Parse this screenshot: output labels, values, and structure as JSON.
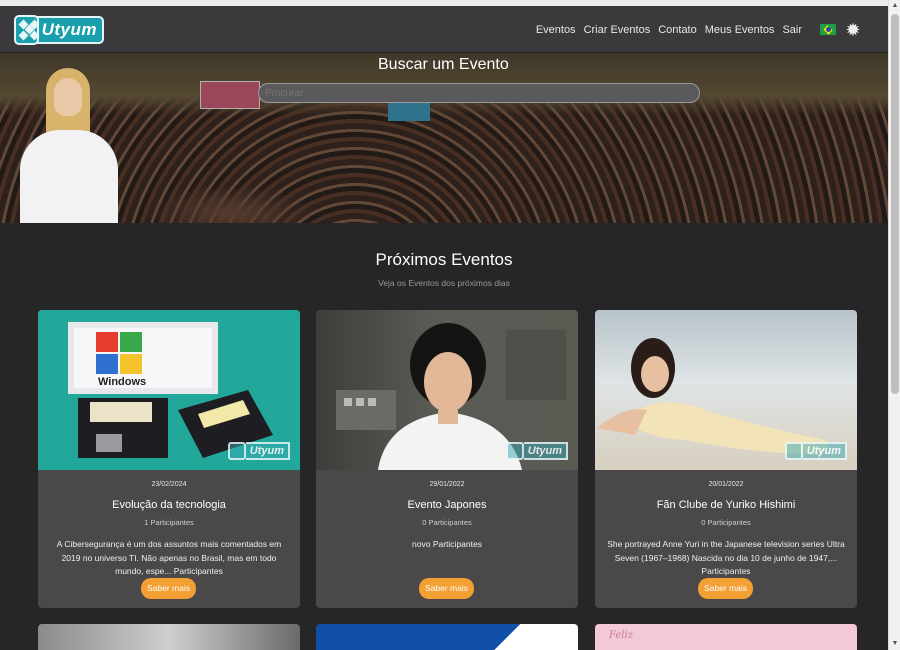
{
  "nav": {
    "logo_text": "Utyum",
    "items": [
      "Eventos",
      "Criar Eventos",
      "Contato",
      "Meus Eventos",
      "Sair"
    ],
    "language_icon": "brazil-flag-icon",
    "theme_icon": "sun-icon"
  },
  "hero": {
    "title": "Buscar um Evento",
    "search_placeholder": "Procurar"
  },
  "section": {
    "title": "Próximos Eventos",
    "subtitle": "Veja os Eventos dos próximos dias"
  },
  "cards": [
    {
      "date": "23/02/2024",
      "title": "Evolução da tecnologia",
      "participants": "1 Participantes",
      "description": "A Cibersegurança é um dos assuntos mais comentados em 2019 no universo TI. Não apenas no Brasil, mas em todo mundo, espe... Participantes",
      "button": "Saber mais",
      "watermark": "Utyum"
    },
    {
      "date": "29/01/2022",
      "title": "Evento Japones",
      "participants": "0 Participantes",
      "description": "novo Participantes",
      "button": "Saber mais",
      "watermark": "Utyum"
    },
    {
      "date": "20/01/2022",
      "title": "Fãn Clube de Yuriko Hishimi",
      "participants": "0 Participantes",
      "description": "She portrayed Anne Yuri in the Japanese television series Ultra Seven (1967–1968) Nascida no dia 10 de junho de 1947,... Participantes",
      "button": "Saber mais",
      "watermark": "Utyum"
    }
  ],
  "row2_snippets": [
    "",
    "",
    "Feliz"
  ],
  "scrollbar": {
    "up": "▲",
    "down": "▼"
  }
}
